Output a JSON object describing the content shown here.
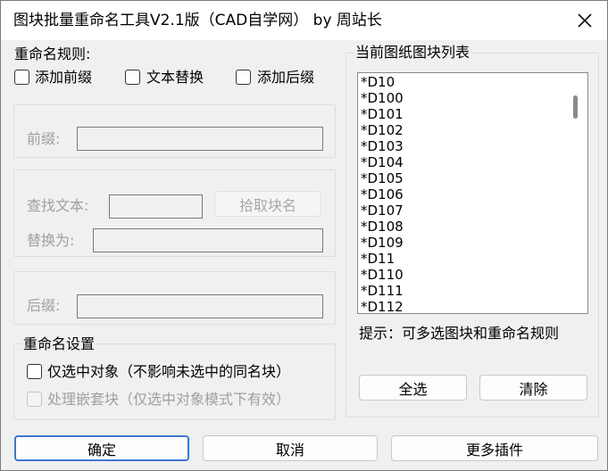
{
  "window": {
    "title": "图块批量重命名工具V2.1版（CAD自学网） by 周站长"
  },
  "rules": {
    "heading": "重命名规则:",
    "options": [
      {
        "label": "添加前缀",
        "checked": false
      },
      {
        "label": "文本替换",
        "checked": false
      },
      {
        "label": "添加后缀",
        "checked": false
      }
    ]
  },
  "prefix": {
    "label": "前缀:",
    "value": ""
  },
  "replace": {
    "find_label": "查找文本:",
    "find_value": "",
    "pick_button": "拾取块名",
    "replace_label": "替换为:",
    "replace_value": ""
  },
  "suffix": {
    "label": "后缀:",
    "value": ""
  },
  "settings": {
    "heading": "重命名设置",
    "option_selected_only": "仅选中对象（不影响未选中的同名块）",
    "option_nested": "处理嵌套块（仅选中对象模式下有效）"
  },
  "block_list": {
    "heading": "当前图纸图块列表",
    "items": [
      "*D10",
      "*D100",
      "*D101",
      "*D102",
      "*D103",
      "*D104",
      "*D105",
      "*D106",
      "*D107",
      "*D108",
      "*D109",
      "*D11",
      "*D110",
      "*D111",
      "*D112"
    ]
  },
  "hint": "提示：可多选图块和重命名规则",
  "buttons": {
    "select_all": "全选",
    "clear": "清除",
    "ok": "确定",
    "cancel": "取消",
    "more_plugins": "更多插件"
  }
}
